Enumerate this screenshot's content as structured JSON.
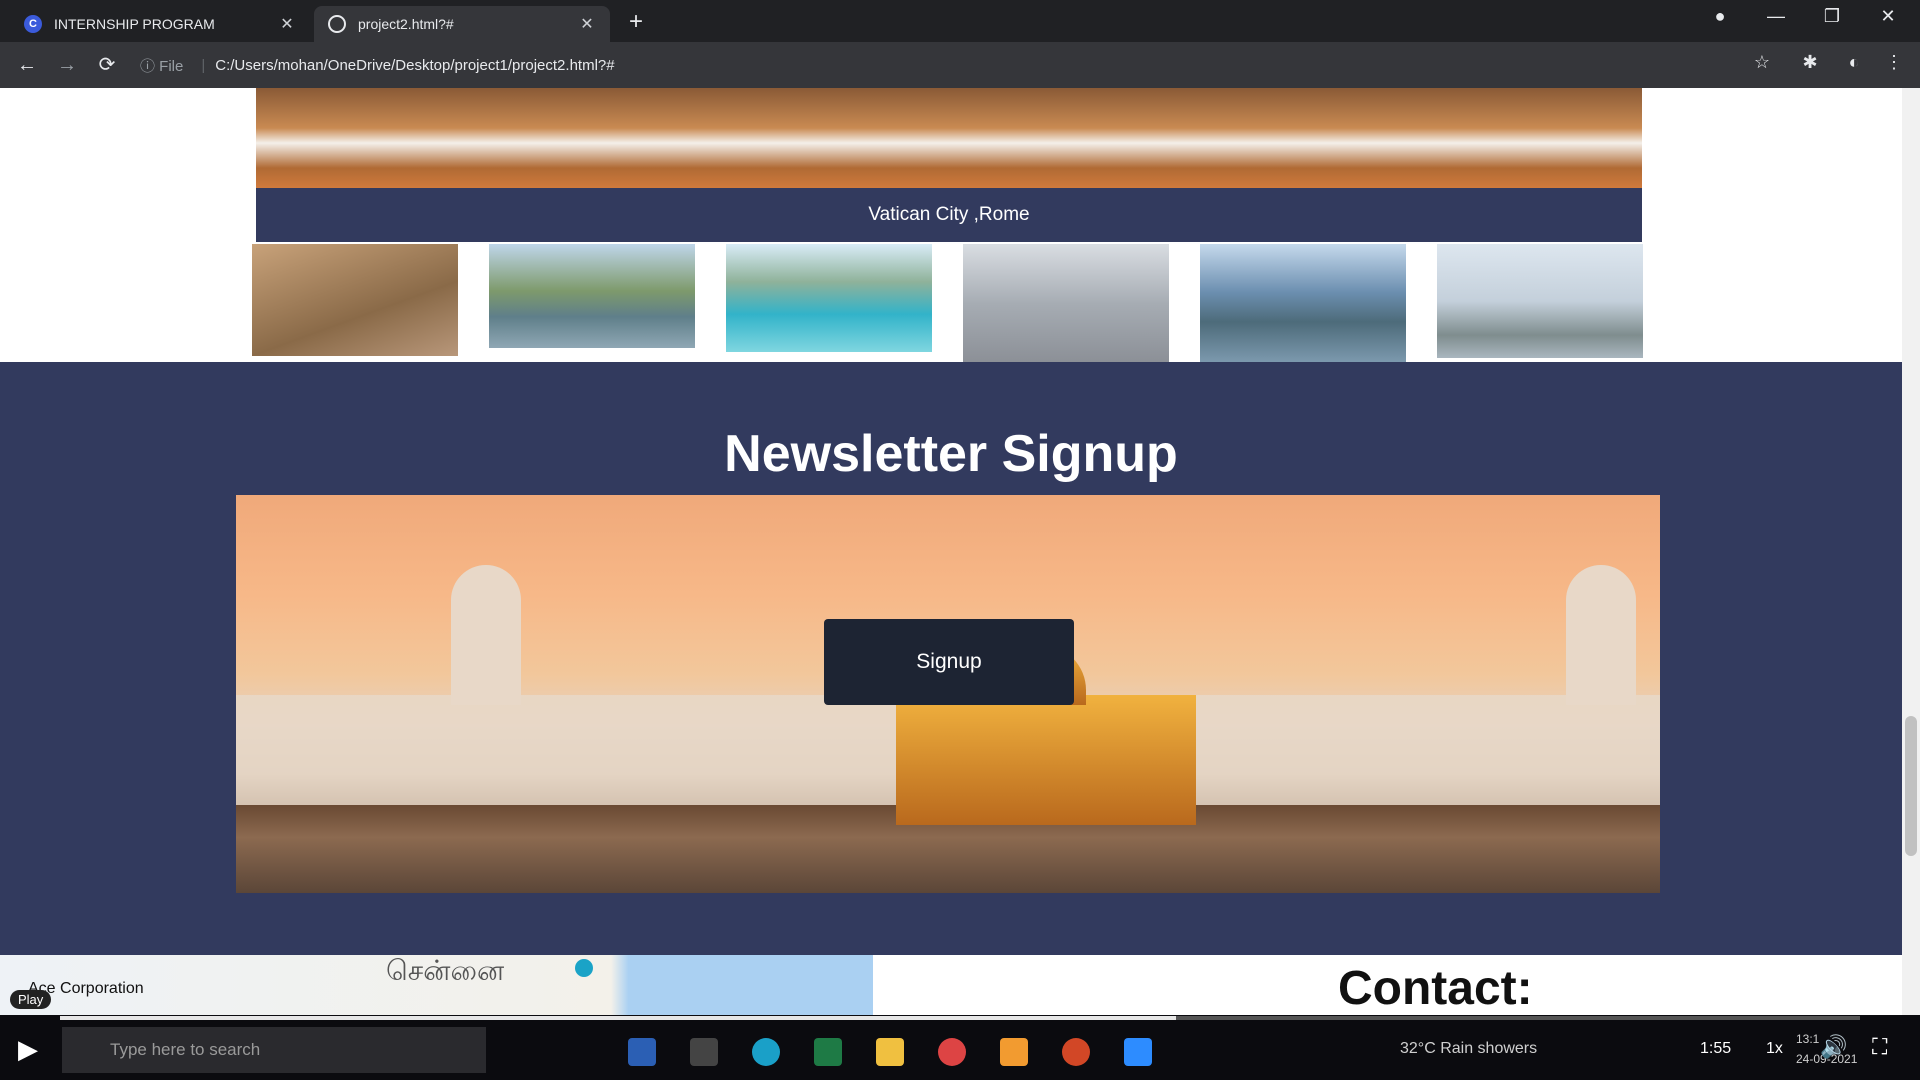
{
  "browser": {
    "tabs": [
      {
        "label": "INTERNSHIP PROGRAM",
        "favicon": "C",
        "favicon_color": "#3b5bdb"
      },
      {
        "label": "project2.html?#",
        "favicon": "globe-icon"
      }
    ],
    "new_tab": "+",
    "window_controls": {
      "minimize": "—",
      "restore": "❐",
      "close": "✕"
    },
    "nav": {
      "back": "←",
      "forward": "→",
      "reload": "⟳"
    },
    "url_info": "ⓘ File",
    "url": "C:/Users/mohan/OneDrive/Desktop/project1/project2.html?#"
  },
  "gallery": {
    "caption": "Vatican City ,Rome",
    "thumb_colors": [
      "#a07b57",
      "#6d8c6a",
      "#4fb3c9",
      "#9aa0a8",
      "#6a8fa8",
      "#c8d2dc"
    ]
  },
  "newsletter": {
    "title": "Newsletter Signup",
    "button_label": "Signup"
  },
  "footer": {
    "map_label": "சென்னை",
    "map_place": "Ace Corporation",
    "contact_title": "Contact:"
  },
  "player": {
    "play_badge": "Play",
    "search_placeholder": "Type here to search",
    "weather": "32°C  Rain showers",
    "time_elapsed": "1:55",
    "speed": "1x",
    "clock_time": "13:1",
    "clock_date": "24-09-2021"
  },
  "colors": {
    "page_bg": "#ffffff",
    "section_bg": "#323a5e",
    "button_bg": "#1d2433"
  }
}
